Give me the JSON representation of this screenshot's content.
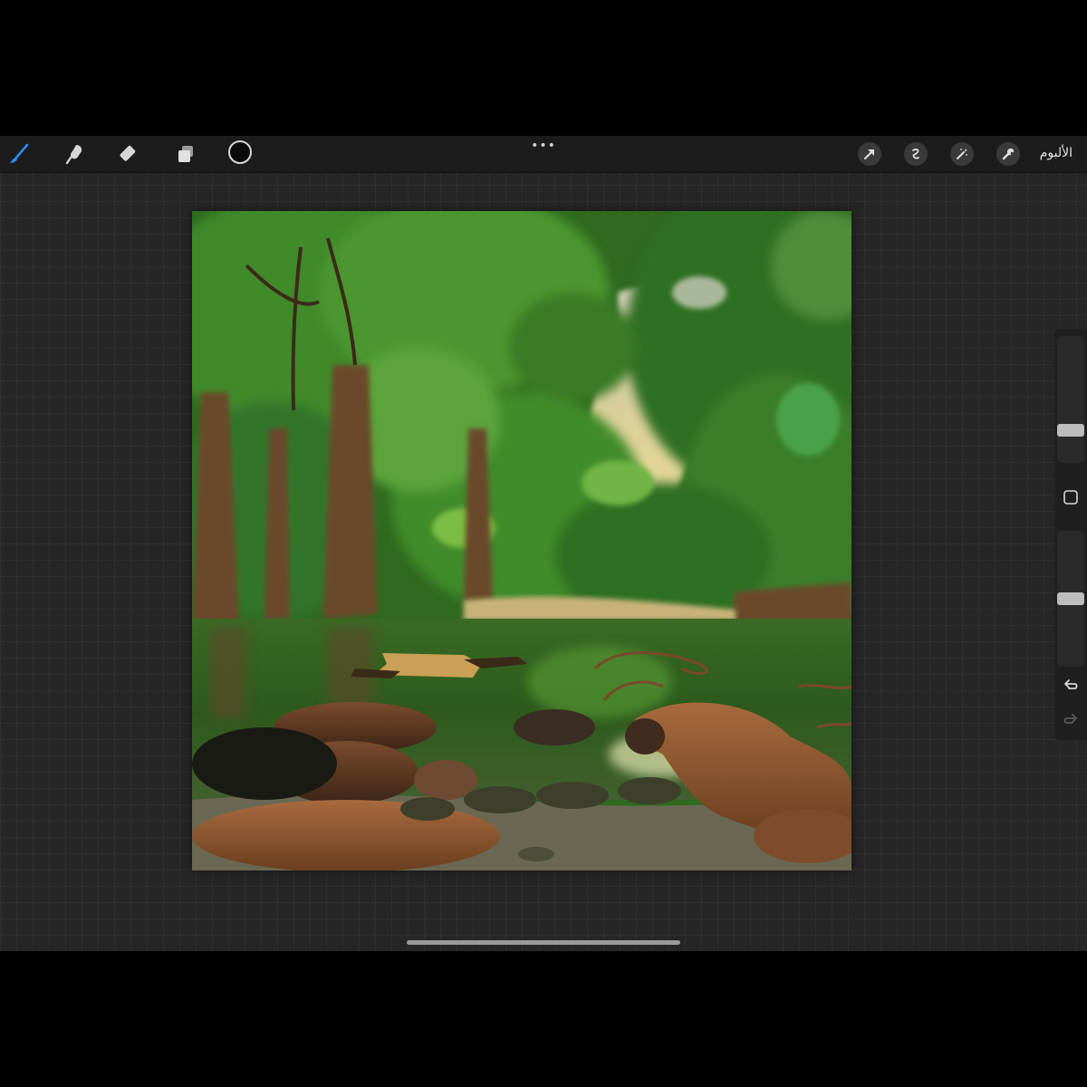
{
  "toolbar": {
    "left_tools": [
      {
        "name": "brush",
        "icon": "brush-icon",
        "active": true,
        "color": "#2f8cf5"
      },
      {
        "name": "smudge",
        "icon": "smudge-icon",
        "active": false
      },
      {
        "name": "eraser",
        "icon": "eraser-icon",
        "active": false
      },
      {
        "name": "layers",
        "icon": "layers-icon",
        "active": false
      }
    ],
    "current_color": "#0b0b0b",
    "more_icon": "more-dots-icon",
    "right_tools": [
      "transform-arrow-icon",
      "selection-icon",
      "adjustments-wand-icon",
      "actions-wrench-icon"
    ],
    "gallery_label": "الألبوم"
  },
  "sidebar": {
    "brush_size_level": 0.77,
    "opacity_level": 0.5,
    "undo_icon": "undo-icon",
    "redo_icon": "redo-icon",
    "modify_icon": "modify-square-icon"
  },
  "canvas": {
    "content": "painting",
    "palette": {
      "foliage_dark": "#1f4a17",
      "foliage_light": "#4f9a2c",
      "sky": "#d8d3b2",
      "water": "#2f5a22",
      "rock": "#8a5330"
    }
  }
}
